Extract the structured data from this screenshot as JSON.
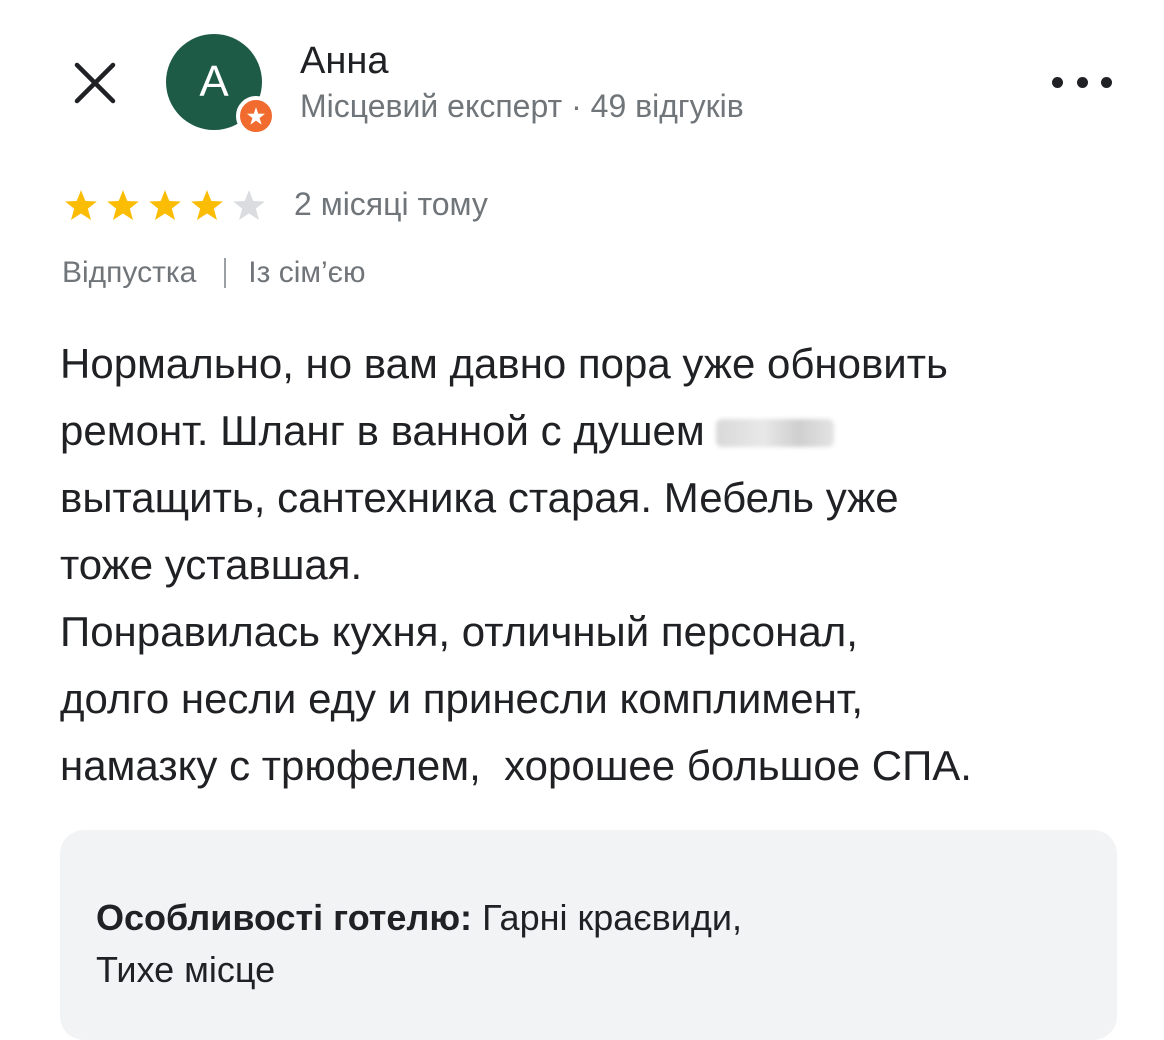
{
  "header": {
    "author_name": "Анна",
    "author_meta": "Місцевий експерт · 49 відгуків",
    "avatar_initial": "A",
    "avatar_color": "#1e5b46",
    "badge_color": "#f26b2e"
  },
  "review": {
    "rating": 4,
    "rating_max": 5,
    "star_color": "#fbbc04",
    "star_empty_color": "#dadce0",
    "date": "2 місяці тому",
    "tags": [
      "Відпустка",
      "Із сім’єю"
    ],
    "text_part1": "Нормально, но вам давно пора уже обновить\nремонт. Шланг в ванной с душем ",
    "text_part2": "\nвытащить, сантехника старая. Мебель уже\nтоже уставшая.\nПонравилась кухня, отличный персонал,\nдолго несли еду и принесли комплимент,\nнамазку с трюфелем,  хорошее большое СПА."
  },
  "highlights": {
    "label": "Особливості готелю:",
    "value": "Гарні краєвиди,\nТихе місце"
  }
}
